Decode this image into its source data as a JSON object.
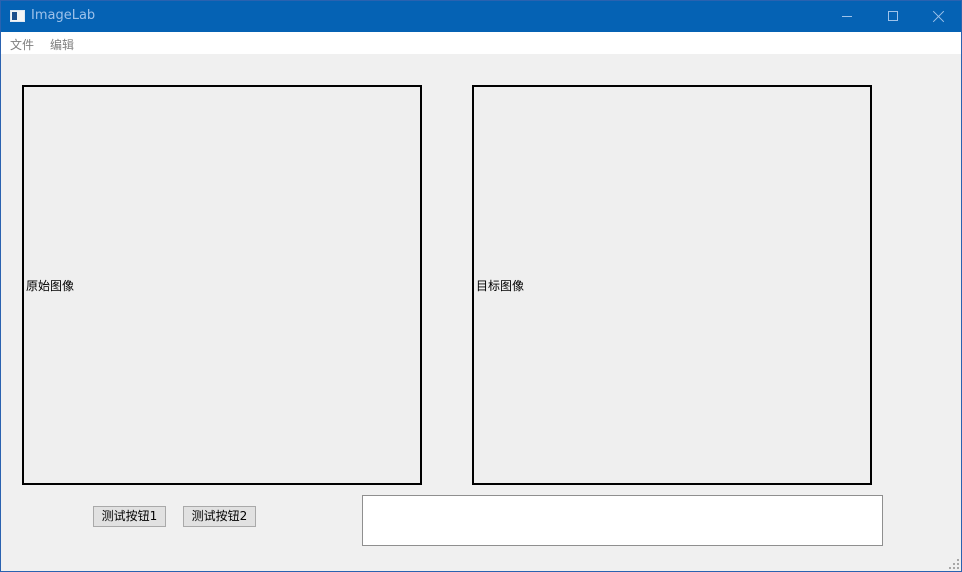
{
  "window": {
    "title": "ImageLab",
    "icon": "app-window-icon"
  },
  "window_controls": {
    "minimize_icon": "minimize-icon",
    "maximize_icon": "maximize-icon",
    "close_icon": "close-icon"
  },
  "menu": {
    "items": [
      {
        "label": "文件"
      },
      {
        "label": "编辑"
      }
    ]
  },
  "panels": {
    "original": {
      "label": "原始图像"
    },
    "target": {
      "label": "目标图像"
    }
  },
  "buttons": {
    "test1": "测试按钮1",
    "test2": "测试按钮2"
  },
  "output": {
    "value": ""
  },
  "colors": {
    "titlebar": "#0562b4",
    "background": "#f0f0f0",
    "panel_border": "#000000"
  }
}
